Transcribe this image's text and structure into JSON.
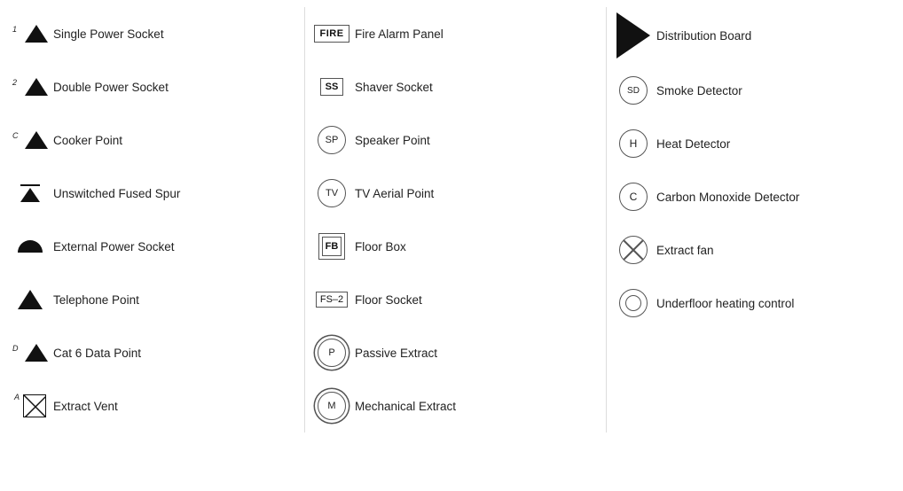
{
  "columns": [
    {
      "items": [
        {
          "id": "single-power-socket",
          "label": "Single Power Socket",
          "iconType": "triangle-1"
        },
        {
          "id": "double-power-socket",
          "label": "Double Power Socket",
          "iconType": "triangle-2"
        },
        {
          "id": "cooker-point",
          "label": "Cooker Point",
          "iconType": "cooker"
        },
        {
          "id": "unswitched-fused-spur",
          "label": "Unswitched Fused Spur",
          "iconType": "fused-spur"
        },
        {
          "id": "external-power-socket",
          "label": "External Power Socket",
          "iconType": "external"
        },
        {
          "id": "telephone-point",
          "label": "Telephone Point",
          "iconType": "telephone"
        },
        {
          "id": "cat6-data-point",
          "label": "Cat 6 Data Point",
          "iconType": "cat6"
        },
        {
          "id": "extract-vent",
          "label": "Extract Vent",
          "iconType": "extract-vent"
        }
      ]
    },
    {
      "items": [
        {
          "id": "fire-alarm-panel",
          "label": "Fire Alarm Panel",
          "iconType": "fire-box",
          "iconText": "FIRE"
        },
        {
          "id": "shaver-socket",
          "label": "Shaver Socket",
          "iconType": "ss-box",
          "iconText": "SS"
        },
        {
          "id": "speaker-point",
          "label": "Speaker Point",
          "iconType": "circle-text",
          "iconText": "SP"
        },
        {
          "id": "tv-aerial-point",
          "label": "TV Aerial Point",
          "iconType": "circle-text",
          "iconText": "TV"
        },
        {
          "id": "floor-box",
          "label": "Floor Box",
          "iconType": "fb-box",
          "iconText": "FB"
        },
        {
          "id": "floor-socket",
          "label": "Floor Socket",
          "iconType": "fs-box",
          "iconText": "FS–2"
        },
        {
          "id": "passive-extract",
          "label": "Passive Extract",
          "iconType": "p-double",
          "iconText": "P"
        },
        {
          "id": "mechanical-extract",
          "label": "Mechanical Extract",
          "iconType": "m-double",
          "iconText": "M"
        }
      ]
    },
    {
      "items": [
        {
          "id": "distribution-board",
          "label": "Distribution Board",
          "iconType": "dist-board"
        },
        {
          "id": "smoke-detector",
          "label": "Smoke Detector",
          "iconType": "sd-circle",
          "iconText": "SD"
        },
        {
          "id": "heat-detector",
          "label": "Heat Detector",
          "iconType": "h-circle",
          "iconText": "H"
        },
        {
          "id": "carbon-monoxide-detector",
          "label": "Carbon Monoxide Detector",
          "iconType": "c-circle",
          "iconText": "C"
        },
        {
          "id": "extract-fan",
          "label": "Extract fan",
          "iconType": "extract-fan"
        },
        {
          "id": "underfloor-heating-control",
          "label": "Underfloor heating control",
          "iconType": "underfloor"
        }
      ]
    }
  ]
}
